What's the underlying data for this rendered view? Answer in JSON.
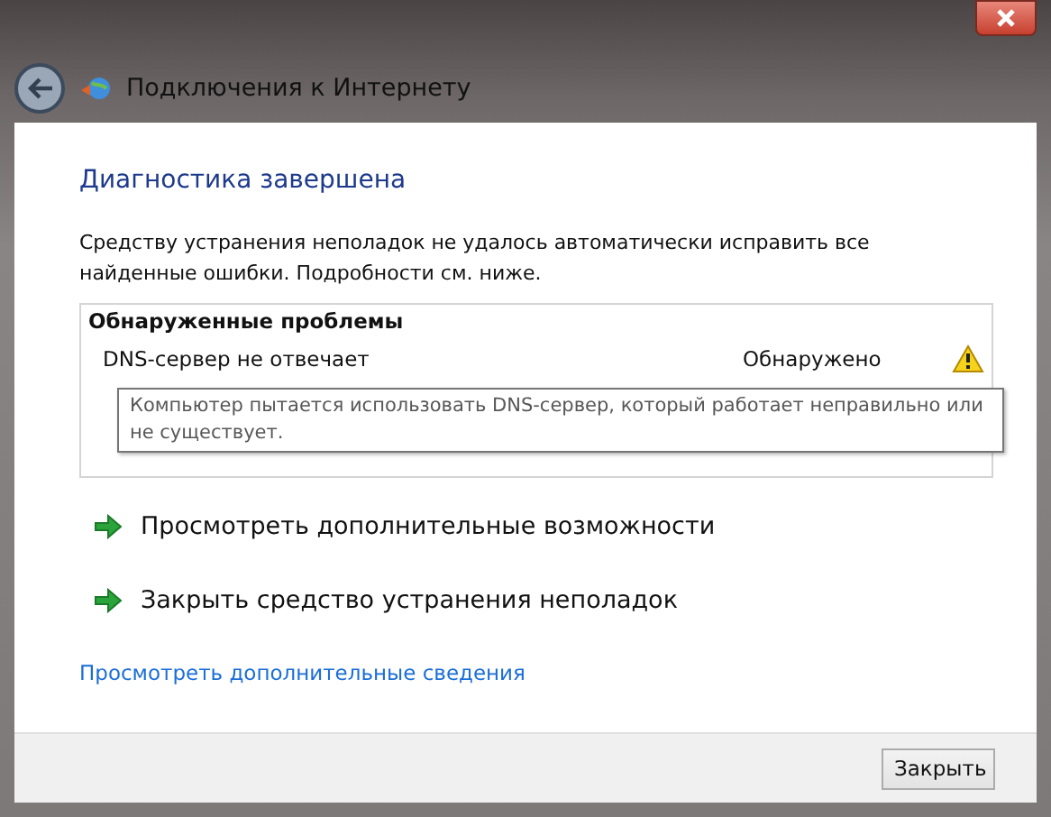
{
  "window": {
    "title": "Подключения к Интернету"
  },
  "heading": "Диагностика завершена",
  "description": "Средству устранения неполадок не удалось автоматически исправить все найденные ошибки. Подробности см. ниже.",
  "problems": {
    "title": "Обнаруженные проблемы",
    "items": [
      {
        "name": "DNS-сервер не отвечает",
        "status": "Обнаружено",
        "kind": "warning"
      }
    ],
    "tooltip": "Компьютер пытается использовать DNS-сервер, который работает неправильно или не существует."
  },
  "actions": [
    "Просмотреть дополнительные возможности",
    "Закрыть средство устранения неполадок"
  ],
  "details_link": "Просмотреть дополнительные сведения",
  "buttons": [
    "Закрыть"
  ]
}
